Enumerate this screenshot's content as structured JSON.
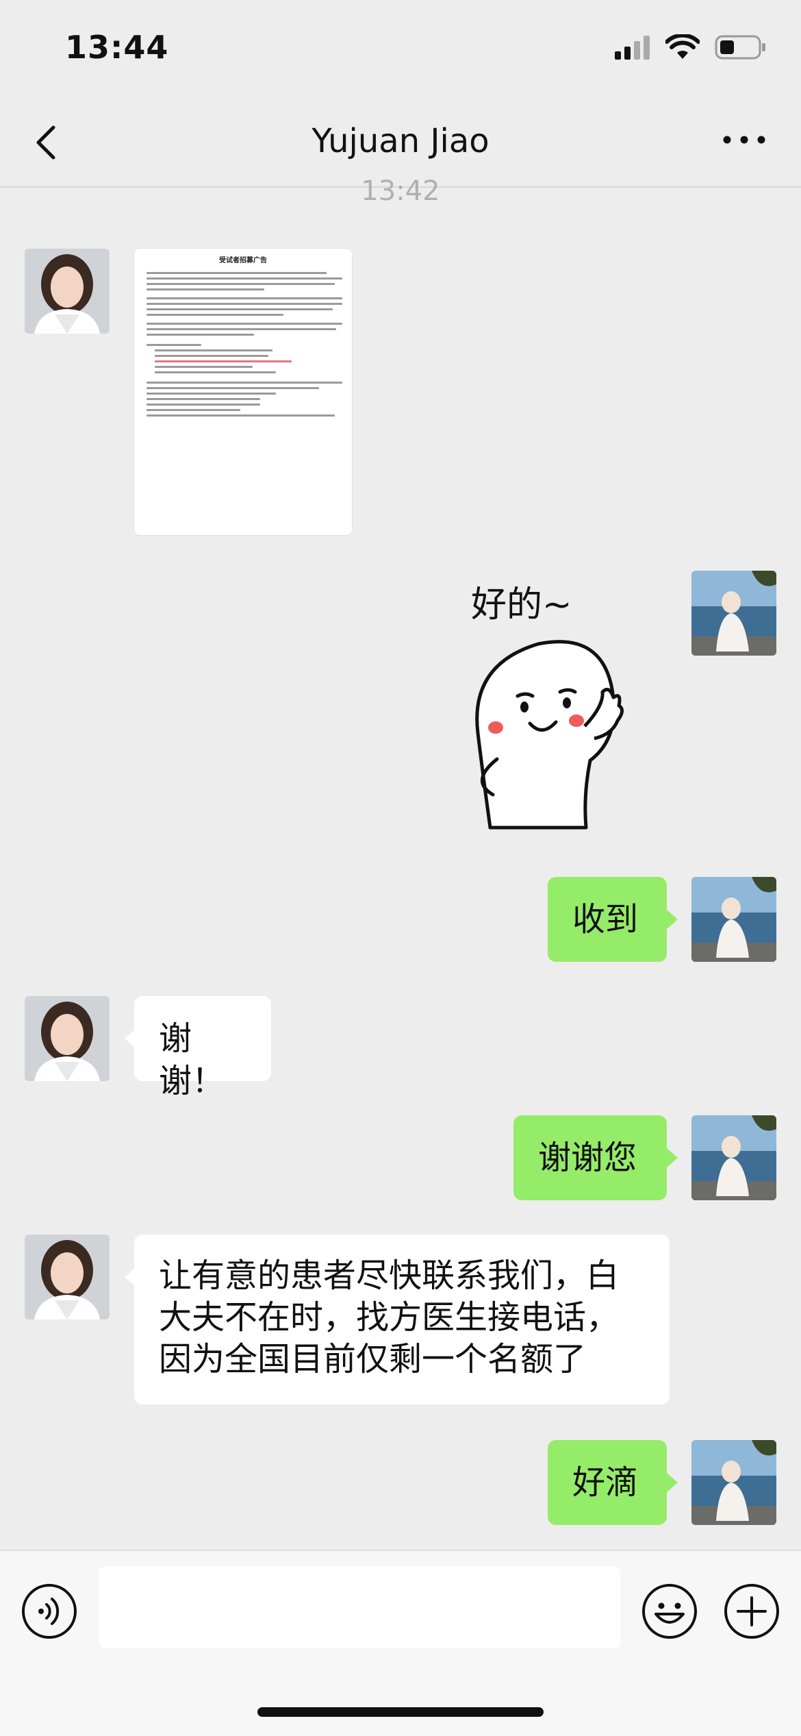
{
  "status_bar": {
    "time": "13:44",
    "icons": [
      "signal-icon",
      "wifi-icon",
      "battery-icon"
    ]
  },
  "header": {
    "title": "Yujuan Jiao",
    "back_icon": "chevron-left-icon",
    "more_icon": "more-icon"
  },
  "timestamp": "13:42",
  "messages": [
    {
      "side": "incoming",
      "type": "document-image",
      "doc_title": "受试者招募广告"
    },
    {
      "side": "outgoing",
      "type": "sticker",
      "text": "好的~"
    },
    {
      "side": "outgoing",
      "type": "text",
      "text": "收到"
    },
    {
      "side": "incoming",
      "type": "text",
      "text": "谢谢！"
    },
    {
      "side": "outgoing",
      "type": "text",
      "text": "谢谢您"
    },
    {
      "side": "incoming",
      "type": "text",
      "lines": [
        "让有意的患者尽快联系我们，白",
        "大夫不在时，找方医生接电话，",
        "因为全国目前仅剩一个名额了"
      ]
    },
    {
      "side": "outgoing",
      "type": "text",
      "text": "好滴"
    }
  ],
  "input_bar": {
    "voice_icon": "voice-icon",
    "emoji_icon": "emoji-icon",
    "plus_icon": "plus-icon",
    "placeholder": ""
  },
  "colors": {
    "background": "#ededed",
    "outgoing_bubble": "#95ec69",
    "incoming_bubble": "#ffffff"
  }
}
